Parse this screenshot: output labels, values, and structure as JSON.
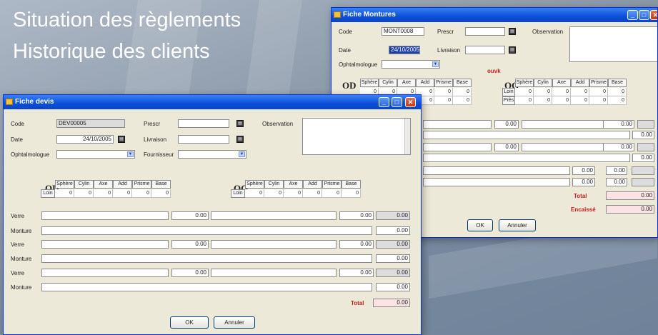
{
  "headline": {
    "line1": "Situation des règlements",
    "line2": "Historique des clients"
  },
  "window_controls": {
    "minimize": "_",
    "maximize": "□",
    "close": "✕"
  },
  "monture": {
    "title": "Fiche Montures",
    "code_label": "Code",
    "code_value": "MONT0008",
    "prescr_label": "Prescr",
    "observation_label": "Observation",
    "date_label": "Date",
    "date_value": "24/10/2005",
    "livraison_label": "Livraison",
    "ophtalmologue_label": "Ophtalmologue",
    "status": "ouvk",
    "od_label": "OD",
    "og_label": "OG",
    "cols": [
      "Sphère",
      "Cylin",
      "Axe",
      "Add",
      "Prisme",
      "Base"
    ],
    "od_rows": [
      {
        "label": "",
        "values": [
          "0",
          "0",
          "0",
          "0",
          "0",
          "0"
        ]
      },
      {
        "label": "",
        "values": [
          "0",
          "0",
          "0",
          "0",
          "0",
          "0"
        ]
      }
    ],
    "og_rows": [
      {
        "label": "Loin",
        "values": [
          "0",
          "0",
          "0",
          "0",
          "0",
          "0"
        ]
      },
      {
        "label": "Près",
        "values": [
          "0",
          "0",
          "0",
          "0",
          "0",
          "0"
        ]
      }
    ],
    "amounts": [
      "0.00",
      "0.00",
      "0.00",
      "0.00",
      "0.00",
      "0.00",
      "0.00",
      "0.00",
      "0.00",
      "0.00"
    ],
    "small_values": [
      "0.00",
      "0.00"
    ],
    "total_label": "Total",
    "total_value": "0.00",
    "encaisse_label": "Encaissé",
    "encaisse_value": "0.00",
    "ok_label": "OK",
    "annuler_label": "Annuler"
  },
  "devis": {
    "title": "Fiche devis",
    "code_label": "Code",
    "code_value": "DEV00005",
    "prescr_label": "Prescr",
    "observation_label": "Observation",
    "date_label": "Date",
    "date_value": "24/10/2005",
    "livraison_label": "Livraison",
    "ophtalmologue_label": "Ophtalmologue",
    "fournisseur_label": "Fournisseur",
    "od_label": "OD",
    "og_label": "OG",
    "cols": [
      "Sphère",
      "Cylin",
      "Axe",
      "Add",
      "Prisme",
      "Base"
    ],
    "loin_label": "Loin",
    "od_values": [
      "0",
      "0",
      "0",
      "0",
      "0",
      "0"
    ],
    "og_values": [
      "0",
      "0",
      "0",
      "0",
      "0",
      "0"
    ],
    "lines": [
      {
        "label": "Verre",
        "mid": "0.00",
        "right": "0.00",
        "end": "0.00"
      },
      {
        "label": "Monture",
        "end": "0.00"
      },
      {
        "label": "Verre",
        "mid": "0.00",
        "right": "0.00",
        "end": "0.00"
      },
      {
        "label": "Monture",
        "end": "0.00"
      },
      {
        "label": "Verre",
        "mid": "0.00",
        "right": "0.00",
        "end": "0.00"
      },
      {
        "label": "Monture",
        "end": "0.00"
      }
    ],
    "total_label": "Total",
    "total_value": "0.00",
    "ok_label": "OK",
    "annuler_label": "Annuler"
  }
}
